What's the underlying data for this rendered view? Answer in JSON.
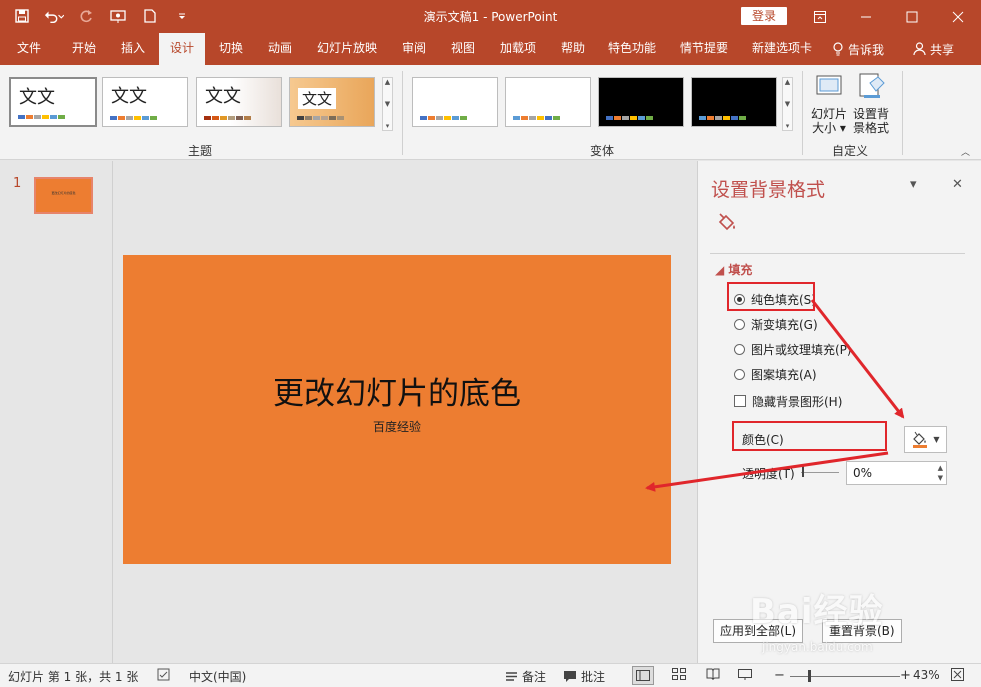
{
  "window": {
    "title": "演示文稿1 - PowerPoint",
    "login_label": "登录"
  },
  "tabs": [
    "文件",
    "开始",
    "插入",
    "设计",
    "切换",
    "动画",
    "幻灯片放映",
    "审阅",
    "视图",
    "加载项",
    "帮助",
    "特色功能",
    "情节提要",
    "新建选项卡"
  ],
  "active_tab": "设计",
  "tell_me": "告诉我",
  "share": "共享",
  "ribbon": {
    "themes_group": "主题",
    "variants_group": "变体",
    "customize_group": "自定义",
    "theme_text": "文文",
    "slide_size_label_1": "幻灯片",
    "slide_size_label_2": "大小",
    "format_bg_label_1": "设置背",
    "format_bg_label_2": "景格式"
  },
  "slide_panel": {
    "slide_number": "1"
  },
  "slide": {
    "title": "更改幻灯片的底色",
    "subtitle": "百度经验",
    "background_color": "#ED7D31"
  },
  "format_pane": {
    "title": "设置背景格式",
    "section": "填充",
    "options": [
      {
        "label": "纯色填充(S)",
        "selected": true
      },
      {
        "label": "渐变填充(G)",
        "selected": false
      },
      {
        "label": "图片或纹理填充(P)",
        "selected": false
      },
      {
        "label": "图案填充(A)",
        "selected": false
      }
    ],
    "hide_bg_graphics": "隐藏背景图形(H)",
    "color_label": "颜色(C)",
    "transparency_label": "透明度(T)",
    "transparency_value": "0%",
    "apply_all_button": "应用到全部(L)",
    "reset_button": "重置背景(B)"
  },
  "watermark": {
    "logo": "Bai经验",
    "url": "jingyan.baidu.com"
  },
  "status_bar": {
    "slide_info": "幻灯片 第 1 张，共 1 张",
    "language": "中文(中国)",
    "notes": "备注",
    "comments": "批注",
    "zoom": "43%"
  },
  "colors": {
    "accent": "#B7472A",
    "annotation": "#E0262B"
  }
}
